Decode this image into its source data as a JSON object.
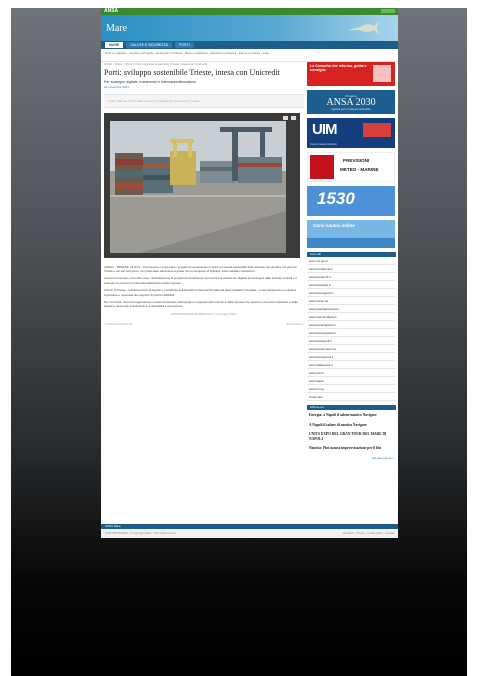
{
  "topbar": {
    "logo": "ANSA"
  },
  "header": {
    "section_title": "Mare"
  },
  "menu": [
    "MARE",
    "SALUTE E SICUREZZA",
    "PORTI"
  ],
  "subnav": "Porti e Logistica - Cantieri e Progetti - Ambiente e Turismo - Mare e Ambiente - Istituzioni e Ricerca - Eventi e Cultura - Foto",
  "article": {
    "breadcrumb": "ANSA > Mare > Porti > Porti: sviluppo sostenibile Trieste, intesa con Unicredit",
    "title": "Porti: sviluppo sostenibile Trieste, intesa con Unicredit",
    "subtitle": "Per sostegno digitale, transizione e internazionalizzazione",
    "date": "24 novembre 2021",
    "sharebar": "Invia | Stampa | Scrivi alla redazione | Suggerisci | Facebook | Twitter",
    "paragraphs": [
      "(ANSA) - TRIESTE, 24 NOV - Promuovere e supportare i progetti di investimento in ottica di crescita sostenibile delle aziende che operano nel porto di Trieste e nel suo retroporto, con particolare attenzione a quelle che si occupano di logistica, intermodalità e spedizioni.",
      "L'accordo prevede, tra le altre cose, l'individuazione di progetti di investimento per favorire la transizione digitale ed ecologica delle aziende portuali e il sostegno ai processi di internazionalizzazione delle imprese.",
      "Il Porto di Trieste - sottolinea Zeno D'Agostino, presidente dell'Autorità di Sistema Portuale del Mare Adriatico Orientale - si sta sviluppando in maniera importante e necessita del supporto di partner affidabili.",
      "Per UniCredit, l'accordo rappresenta un ulteriore tassello nell'impegno a supporto del territorio e delle imprese che operano nel settore marittimo e della logistica, favorendo investimenti in sostenibilità e innovazione."
    ],
    "caption": "RIPRODUZIONE RISERVATA © Copyright ANSA",
    "prev": "< Articolo precedente",
    "next": "Successivo >"
  },
  "sidebar": {
    "ad1": "La Consulta che informa, guida e consiglia",
    "ad2_top": "Progetto",
    "ad2_main": "ANSA 2030",
    "ad2_sub": "Agenda per lo sviluppo sostenibile",
    "ad3": "UIM",
    "ad3_sub": "Unione Italiana Marittimi",
    "ad4_line1": "PREVISIONI",
    "ad4_line2": "METEO - MARINE",
    "ad5": "1530",
    "ad6": "Corsi nautici online",
    "links_title": "Link utili",
    "links": [
      "www.mit.gov.it",
      "www.confitarma.it",
      "www.assoporti.it",
      "www.fedepiloti.it",
      "www.federagenti.it",
      "www.ucina.net",
      "www.guardiacostiera.it",
      "www.marina.difesa.it",
      "www.assologistica.it",
      "www.federlogistica.it",
      "www.fedespedi.it",
      "www.assarmatori.eu",
      "www.federpesca.it",
      "www.italiapesca.it",
      "www.anci.it",
      "www.lega.it",
      "www.itf.org",
      "Ciranmare"
    ],
    "news_title": "Ultima ora",
    "news": [
      "Energia: a Napoli il salone nautico Navigare",
      "A Napoli il salone di nautica Navigare",
      "UNITS EXPO DEL GRAN TOUR DEL MARE DI NAPOLI",
      "Nautica: Pini manca improvvisazione per il blu"
    ],
    "more": "Vai alla rubrica >"
  },
  "footer": {
    "bar": "ANSA Mare",
    "left": "P.IVA 00876481003 - © Copyright ANSA - Tutti i diritti riservati",
    "right": "Chi siamo - Privacy - Cookie policy - Contatti"
  }
}
